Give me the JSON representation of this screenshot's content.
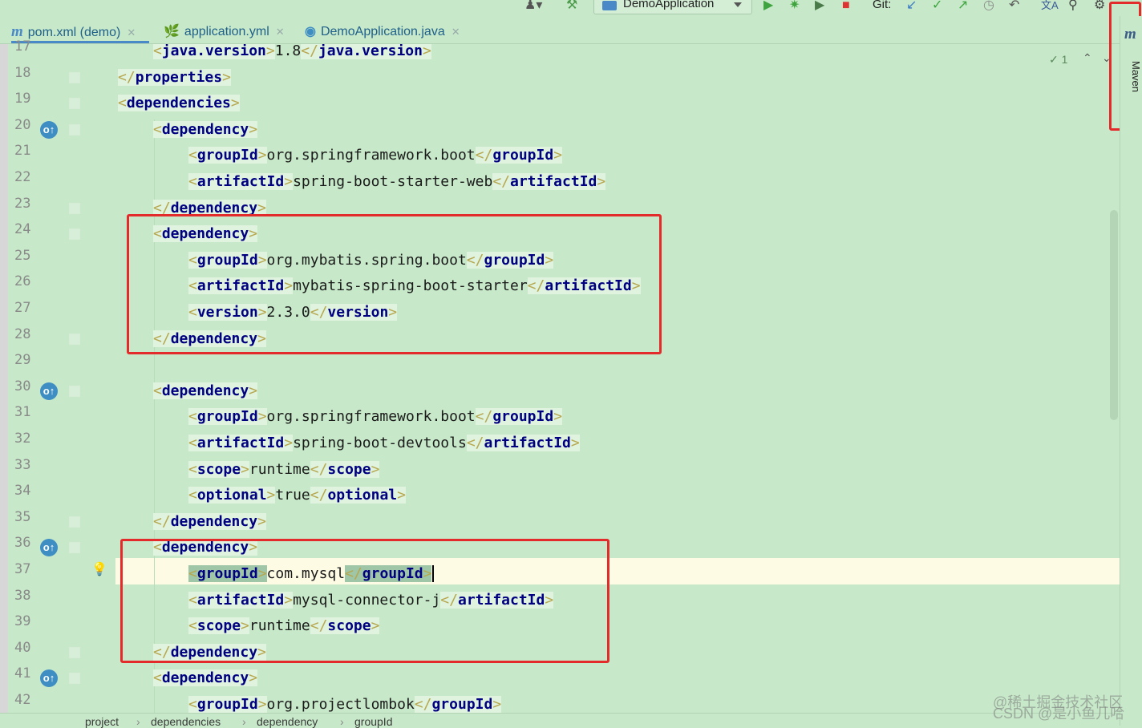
{
  "toolbar": {
    "run_config": "DemoApplication",
    "git_label": "Git:",
    "icons": [
      "user-icon",
      "hammer-icon",
      "run-icon",
      "debug-icon",
      "coverage-icon",
      "stop-icon",
      "git-update-icon",
      "git-commit-icon",
      "git-push-icon",
      "history-icon",
      "rollback-icon",
      "translate-icon",
      "search-icon",
      "settings-icon"
    ]
  },
  "tabs": [
    {
      "label": "pom.xml (demo)",
      "icon": "maven-file-icon",
      "active": true
    },
    {
      "label": "application.yml",
      "icon": "yaml-file-icon",
      "active": false
    },
    {
      "label": "DemoApplication.java",
      "icon": "java-class-icon",
      "active": false
    }
  ],
  "editor": {
    "inspection_count": "1",
    "current_line": 37,
    "lines": [
      {
        "n": "17",
        "indent": 2,
        "parts": [
          {
            "t": "b",
            "v": "<"
          },
          {
            "t": "tag",
            "v": "java.version"
          },
          {
            "t": "b",
            "v": ">"
          },
          {
            "t": "x",
            "v": "1.8"
          },
          {
            "t": "b",
            "v": "</"
          },
          {
            "t": "tag",
            "v": "java.version"
          },
          {
            "t": "b",
            "v": ">"
          }
        ]
      },
      {
        "n": "18",
        "indent": 1,
        "parts": [
          {
            "t": "b",
            "v": "</"
          },
          {
            "t": "tag",
            "v": "properties"
          },
          {
            "t": "b",
            "v": ">"
          }
        ]
      },
      {
        "n": "19",
        "indent": 1,
        "parts": [
          {
            "t": "b",
            "v": "<"
          },
          {
            "t": "tag",
            "v": "dependencies"
          },
          {
            "t": "b",
            "v": ">"
          }
        ]
      },
      {
        "n": "20",
        "indent": 2,
        "parts": [
          {
            "t": "b",
            "v": "<"
          },
          {
            "t": "tag",
            "v": "dependency"
          },
          {
            "t": "b",
            "v": ">"
          }
        ]
      },
      {
        "n": "21",
        "indent": 3,
        "parts": [
          {
            "t": "b",
            "v": "<"
          },
          {
            "t": "tag",
            "v": "groupId"
          },
          {
            "t": "b",
            "v": ">"
          },
          {
            "t": "x",
            "v": "org.springframework.boot"
          },
          {
            "t": "b",
            "v": "</"
          },
          {
            "t": "tag",
            "v": "groupId"
          },
          {
            "t": "b",
            "v": ">"
          }
        ]
      },
      {
        "n": "22",
        "indent": 3,
        "parts": [
          {
            "t": "b",
            "v": "<"
          },
          {
            "t": "tag",
            "v": "artifactId"
          },
          {
            "t": "b",
            "v": ">"
          },
          {
            "t": "x",
            "v": "spring-boot-starter-web"
          },
          {
            "t": "b",
            "v": "</"
          },
          {
            "t": "tag",
            "v": "artifactId"
          },
          {
            "t": "b",
            "v": ">"
          }
        ]
      },
      {
        "n": "23",
        "indent": 2,
        "parts": [
          {
            "t": "b",
            "v": "</"
          },
          {
            "t": "tag",
            "v": "dependency"
          },
          {
            "t": "b",
            "v": ">"
          }
        ]
      },
      {
        "n": "24",
        "indent": 2,
        "parts": [
          {
            "t": "b",
            "v": "<"
          },
          {
            "t": "tag",
            "v": "dependency"
          },
          {
            "t": "b",
            "v": ">"
          }
        ]
      },
      {
        "n": "25",
        "indent": 3,
        "parts": [
          {
            "t": "b",
            "v": "<"
          },
          {
            "t": "tag",
            "v": "groupId"
          },
          {
            "t": "b",
            "v": ">"
          },
          {
            "t": "x",
            "v": "org.mybatis.spring.boot"
          },
          {
            "t": "b",
            "v": "</"
          },
          {
            "t": "tag",
            "v": "groupId"
          },
          {
            "t": "b",
            "v": ">"
          }
        ]
      },
      {
        "n": "26",
        "indent": 3,
        "parts": [
          {
            "t": "b",
            "v": "<"
          },
          {
            "t": "tag",
            "v": "artifactId"
          },
          {
            "t": "b",
            "v": ">"
          },
          {
            "t": "x",
            "v": "mybatis-spring-boot-starter"
          },
          {
            "t": "b",
            "v": "</"
          },
          {
            "t": "tag",
            "v": "artifactId"
          },
          {
            "t": "b",
            "v": ">"
          }
        ]
      },
      {
        "n": "27",
        "indent": 3,
        "parts": [
          {
            "t": "b",
            "v": "<"
          },
          {
            "t": "tag",
            "v": "version"
          },
          {
            "t": "b",
            "v": ">"
          },
          {
            "t": "x",
            "v": "2.3.0"
          },
          {
            "t": "b",
            "v": "</"
          },
          {
            "t": "tag",
            "v": "version"
          },
          {
            "t": "b",
            "v": ">"
          }
        ]
      },
      {
        "n": "28",
        "indent": 2,
        "parts": [
          {
            "t": "b",
            "v": "</"
          },
          {
            "t": "tag",
            "v": "dependency"
          },
          {
            "t": "b",
            "v": ">"
          }
        ]
      },
      {
        "n": "29",
        "indent": 0,
        "parts": []
      },
      {
        "n": "30",
        "indent": 2,
        "parts": [
          {
            "t": "b",
            "v": "<"
          },
          {
            "t": "tag",
            "v": "dependency"
          },
          {
            "t": "b",
            "v": ">"
          }
        ]
      },
      {
        "n": "31",
        "indent": 3,
        "parts": [
          {
            "t": "b",
            "v": "<"
          },
          {
            "t": "tag",
            "v": "groupId"
          },
          {
            "t": "b",
            "v": ">"
          },
          {
            "t": "x",
            "v": "org.springframework.boot"
          },
          {
            "t": "b",
            "v": "</"
          },
          {
            "t": "tag",
            "v": "groupId"
          },
          {
            "t": "b",
            "v": ">"
          }
        ]
      },
      {
        "n": "32",
        "indent": 3,
        "parts": [
          {
            "t": "b",
            "v": "<"
          },
          {
            "t": "tag",
            "v": "artifactId"
          },
          {
            "t": "b",
            "v": ">"
          },
          {
            "t": "x",
            "v": "spring-boot-devtools"
          },
          {
            "t": "b",
            "v": "</"
          },
          {
            "t": "tag",
            "v": "artifactId"
          },
          {
            "t": "b",
            "v": ">"
          }
        ]
      },
      {
        "n": "33",
        "indent": 3,
        "parts": [
          {
            "t": "b",
            "v": "<"
          },
          {
            "t": "tag",
            "v": "scope"
          },
          {
            "t": "b",
            "v": ">"
          },
          {
            "t": "x",
            "v": "runtime"
          },
          {
            "t": "b",
            "v": "</"
          },
          {
            "t": "tag",
            "v": "scope"
          },
          {
            "t": "b",
            "v": ">"
          }
        ]
      },
      {
        "n": "34",
        "indent": 3,
        "parts": [
          {
            "t": "b",
            "v": "<"
          },
          {
            "t": "tag",
            "v": "optional"
          },
          {
            "t": "b",
            "v": ">"
          },
          {
            "t": "x",
            "v": "true"
          },
          {
            "t": "b",
            "v": "</"
          },
          {
            "t": "tag",
            "v": "optional"
          },
          {
            "t": "b",
            "v": ">"
          }
        ]
      },
      {
        "n": "35",
        "indent": 2,
        "parts": [
          {
            "t": "b",
            "v": "</"
          },
          {
            "t": "tag",
            "v": "dependency"
          },
          {
            "t": "b",
            "v": ">"
          }
        ]
      },
      {
        "n": "36",
        "indent": 2,
        "parts": [
          {
            "t": "b",
            "v": "<"
          },
          {
            "t": "tag",
            "v": "dependency"
          },
          {
            "t": "b",
            "v": ">"
          }
        ]
      },
      {
        "n": "37",
        "indent": 3,
        "parts": [
          {
            "t": "bm",
            "v": "<"
          },
          {
            "t": "tagm",
            "v": "groupId"
          },
          {
            "t": "bm",
            "v": ">"
          },
          {
            "t": "x",
            "v": "com.mysql"
          },
          {
            "t": "bm",
            "v": "</"
          },
          {
            "t": "tagm",
            "v": "groupId"
          },
          {
            "t": "bm",
            "v": ">"
          }
        ]
      },
      {
        "n": "38",
        "indent": 3,
        "parts": [
          {
            "t": "b",
            "v": "<"
          },
          {
            "t": "tag",
            "v": "artifactId"
          },
          {
            "t": "b",
            "v": ">"
          },
          {
            "t": "x",
            "v": "mysql-connector-j"
          },
          {
            "t": "b",
            "v": "</"
          },
          {
            "t": "tag",
            "v": "artifactId"
          },
          {
            "t": "b",
            "v": ">"
          }
        ]
      },
      {
        "n": "39",
        "indent": 3,
        "parts": [
          {
            "t": "b",
            "v": "<"
          },
          {
            "t": "tag",
            "v": "scope"
          },
          {
            "t": "b",
            "v": ">"
          },
          {
            "t": "x",
            "v": "runtime"
          },
          {
            "t": "b",
            "v": "</"
          },
          {
            "t": "tag",
            "v": "scope"
          },
          {
            "t": "b",
            "v": ">"
          }
        ]
      },
      {
        "n": "40",
        "indent": 2,
        "parts": [
          {
            "t": "b",
            "v": "</"
          },
          {
            "t": "tag",
            "v": "dependency"
          },
          {
            "t": "b",
            "v": ">"
          }
        ]
      },
      {
        "n": "41",
        "indent": 2,
        "parts": [
          {
            "t": "b",
            "v": "<"
          },
          {
            "t": "tag",
            "v": "dependency"
          },
          {
            "t": "b",
            "v": ">"
          }
        ]
      },
      {
        "n": "42",
        "indent": 3,
        "parts": [
          {
            "t": "b",
            "v": "<"
          },
          {
            "t": "tag",
            "v": "groupId"
          },
          {
            "t": "b",
            "v": ">"
          },
          {
            "t": "x",
            "v": "org.projectlombok"
          },
          {
            "t": "b",
            "v": "</"
          },
          {
            "t": "tag",
            "v": "groupId"
          },
          {
            "t": "b",
            "v": ">"
          }
        ]
      }
    ],
    "gutter_markers": [
      "20",
      "30",
      "36",
      "41"
    ]
  },
  "right_panel": {
    "maven_label": "Maven",
    "maven_icon": "m"
  },
  "breadcrumb": [
    "project",
    "dependencies",
    "dependency",
    "groupId"
  ],
  "watermark": {
    "line1": "@稀土掘金技术社区",
    "line2": "CSDN @是小鱼儿哈"
  }
}
